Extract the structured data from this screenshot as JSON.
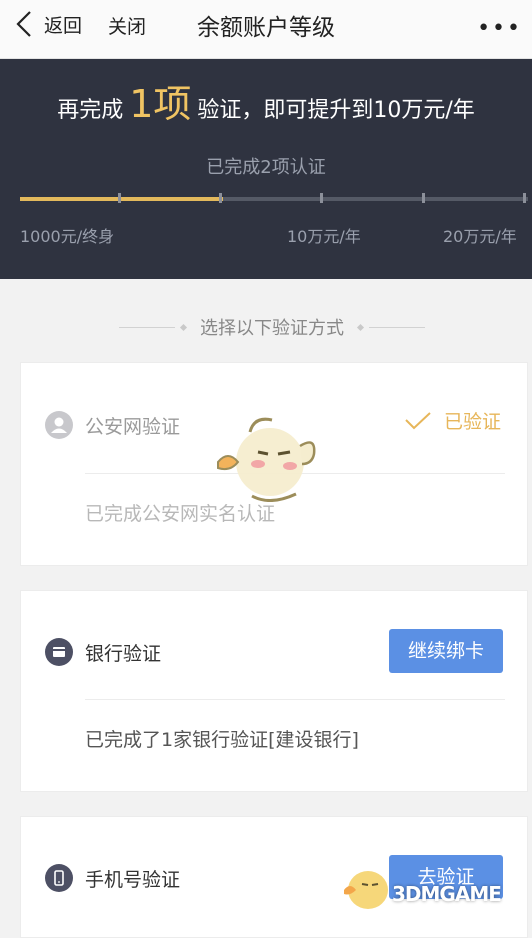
{
  "nav": {
    "back_label": "返回",
    "close_label": "关闭",
    "title": "余额账户等级",
    "more_label": "•••"
  },
  "header": {
    "promo_prefix": "再完成",
    "promo_count": "1项",
    "promo_suffix": "验证，即可提升到10万元/年",
    "completed_text": "已完成2项认证",
    "progress_fraction": 0.4,
    "levels": [
      "1000元/终身",
      "10万元/年",
      "20万元/年"
    ]
  },
  "section_title": "选择以下验证方式",
  "methods": [
    {
      "label": "公安网验证",
      "status": "已验证",
      "desc": "已完成公安网实名认证"
    },
    {
      "label": "银行验证",
      "button": "继续绑卡",
      "desc": "已完成了1家银行验证[建设银行]"
    },
    {
      "label": "手机号验证",
      "button": "去验证"
    }
  ],
  "watermark": "3DMGAME",
  "colors": {
    "accent": "#5b90e4",
    "gold": "#f0c463",
    "header_bg": "#2f3340",
    "verified": "#e7b65a"
  }
}
